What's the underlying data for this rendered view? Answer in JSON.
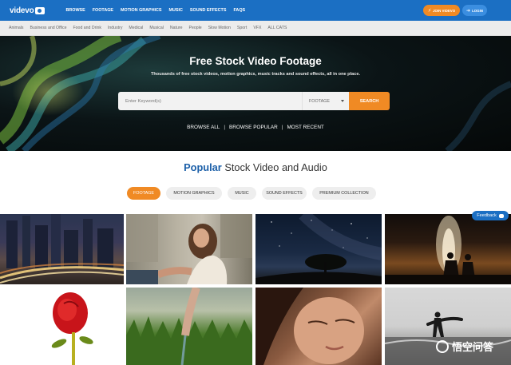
{
  "header": {
    "logo_text": "videvo",
    "nav": [
      "BROWSE",
      "FOOTAGE",
      "MOTION GRAPHICS",
      "MUSIC",
      "SOUND EFFECTS",
      "FAQS"
    ],
    "join_label": "JOIN VIDEVO",
    "login_label": "LOGIN",
    "brand_color": "#1b6fc3",
    "accent_color": "#f08a24"
  },
  "categories": [
    "Animals",
    "Business and Office",
    "Food and Drink",
    "Industry",
    "Medical",
    "Musical",
    "Nature",
    "People",
    "Slow Motion",
    "Sport",
    "VFX",
    "ALL CATS"
  ],
  "hero": {
    "title": "Free Stock Video Footage",
    "subtitle": "Thousands of free stock videos, motion graphics, music tracks and sound effects, all in one place.",
    "search_placeholder": "Enter Keyword(s)",
    "search_type": "FOOTAGE",
    "search_button": "SEARCH",
    "links": [
      "BROWSE ALL",
      "BROWSE POPULAR",
      "MOST RECENT"
    ],
    "link_separator": "|"
  },
  "popular": {
    "title_accent": "Popular",
    "title_rest": "Stock Video and Audio",
    "tabs": [
      {
        "label": "FOOTAGE",
        "active": true
      },
      {
        "label": "MOTION GRAPHICS",
        "active": false
      },
      {
        "label": "MUSIC",
        "active": false
      },
      {
        "label": "SOUND EFFECTS",
        "active": false
      },
      {
        "label": "PREMIUM COLLECTION",
        "active": false
      }
    ]
  },
  "feedback_label": "Feedback",
  "watermark_text": "悟空问答"
}
